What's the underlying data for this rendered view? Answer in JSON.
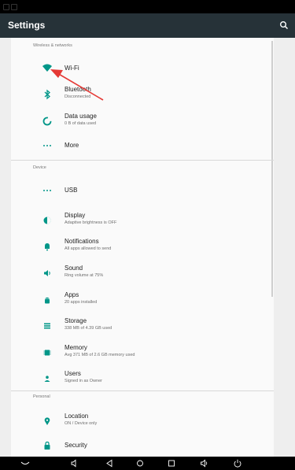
{
  "app_bar": {
    "title": "Settings"
  },
  "sections": {
    "wireless": "Wireless & networks",
    "device": "Device",
    "personal": "Personal"
  },
  "items": {
    "wifi": {
      "title": "Wi-Fi"
    },
    "bluetooth": {
      "title": "Bluetooth",
      "summary": "Disconnected"
    },
    "data_usage": {
      "title": "Data usage",
      "summary": "0 B of data used"
    },
    "more": {
      "title": "More"
    },
    "usb": {
      "title": "USB"
    },
    "display": {
      "title": "Display",
      "summary": "Adaptive brightness is OFF"
    },
    "notifications": {
      "title": "Notifications",
      "summary": "All apps allowed to send"
    },
    "sound": {
      "title": "Sound",
      "summary": "Ring volume at 75%"
    },
    "apps": {
      "title": "Apps",
      "summary": "20 apps installed"
    },
    "storage": {
      "title": "Storage",
      "summary": "338 MB of 4.39 GB used"
    },
    "memory": {
      "title": "Memory",
      "summary": "Avg 371 MB of 2.6 GB memory used"
    },
    "users": {
      "title": "Users",
      "summary": "Signed in as Owner"
    },
    "location": {
      "title": "Location",
      "summary": "ON / Device only"
    },
    "security": {
      "title": "Security"
    }
  },
  "colors": {
    "accent": "#009688",
    "annotation_arrow": "#e53935",
    "app_bar": "#263238"
  },
  "icons": {
    "nav": [
      "collapse-icon",
      "volume-down-icon",
      "back-icon",
      "home-icon",
      "recents-icon",
      "volume-up-icon",
      "power-icon"
    ]
  }
}
